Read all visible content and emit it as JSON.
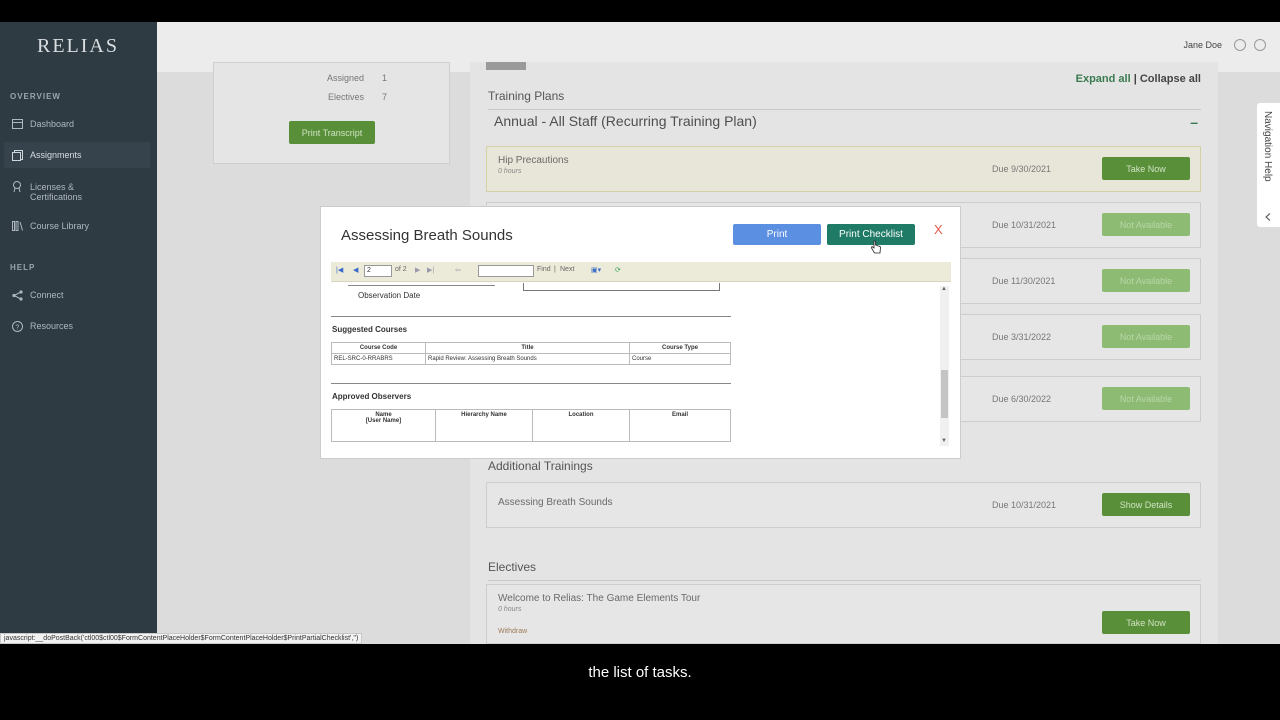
{
  "sidebar": {
    "logo": "RELIAS",
    "overview_head": "OVERVIEW",
    "help_head": "HELP",
    "items": [
      {
        "label": "Dashboard"
      },
      {
        "label": "Assignments"
      },
      {
        "label": "Licenses &"
      },
      {
        "label": "Certifications"
      },
      {
        "label": "Course Library"
      },
      {
        "label": "Connect"
      },
      {
        "label": "Resources"
      }
    ]
  },
  "header": {
    "user": "Jane Doe"
  },
  "left_card": {
    "assigned_label": "Assigned",
    "assigned_value": "1",
    "electives_label": "Electives",
    "electives_value": "7",
    "print_transcript": "Print Transcript"
  },
  "panel": {
    "expand_all": "Expand all",
    "sep": " | ",
    "collapse_all": "Collapse all",
    "training_plans": "Training Plans",
    "plan_title": "Annual - All Staff (Recurring Training Plan)",
    "collapse_symbol": "–",
    "rows": [
      {
        "title": "Hip Precautions",
        "sub": "0 hours",
        "due": "Due 9/30/2021",
        "btn": "Take Now"
      },
      {
        "due": "Due 10/31/2021",
        "btn": "Not Available"
      },
      {
        "due": "Due 11/30/2021",
        "btn": "Not Available"
      },
      {
        "due": "Due 3/31/2022",
        "btn": "Not Available"
      },
      {
        "due": "Due 6/30/2022",
        "btn": "Not Available"
      }
    ],
    "additional_trainings": "Additional Trainings",
    "additional": {
      "title": "Assessing Breath Sounds",
      "due": "Due 10/31/2021",
      "btn": "Show Details"
    },
    "electives": "Electives",
    "elective": {
      "title": "Welcome to Relias: The Game Elements Tour",
      "sub": "0 hours",
      "link": "Withdraw",
      "btn": "Take Now"
    }
  },
  "modal": {
    "title": "Assessing Breath Sounds",
    "print": "Print",
    "print_checklist": "Print Checklist",
    "close": "X",
    "toolbar": {
      "page": "2",
      "of": "of 2",
      "find": "Find",
      "sep": "|",
      "next": "Next"
    },
    "report": {
      "observation_date": "Observation Date",
      "suggested_courses": "Suggested Courses",
      "courses_headers": [
        "Course Code",
        "Title",
        "Course Type"
      ],
      "courses_row": [
        "REL-SRC-0-RRABRS",
        "Rapid Review: Assessing Breath Sounds",
        "Course"
      ],
      "approved_observers": "Approved Observers",
      "observer_headers": [
        "Name",
        "[User Name]",
        "Hierarchy Name",
        "Location",
        "Email"
      ]
    }
  },
  "nav_help": "Navigation Help",
  "status_bar": "javascript:__doPostBack('ctl00$ctl00$FormContentPlaceHolder$FormContentPlaceHolder$PrintPartialChecklist','')",
  "caption": "the list of tasks.",
  "colors": {
    "accent_green": "#5a8f3a",
    "print_blue": "#5b8fe2",
    "checklist_teal": "#1f7a66",
    "sidebar_bg": "#2f3b43"
  },
  "icons": [
    "dashboard-icon",
    "assignments-icon",
    "certificate-icon",
    "library-icon",
    "share-icon",
    "help-icon",
    "settings-icon",
    "logout-icon"
  ]
}
